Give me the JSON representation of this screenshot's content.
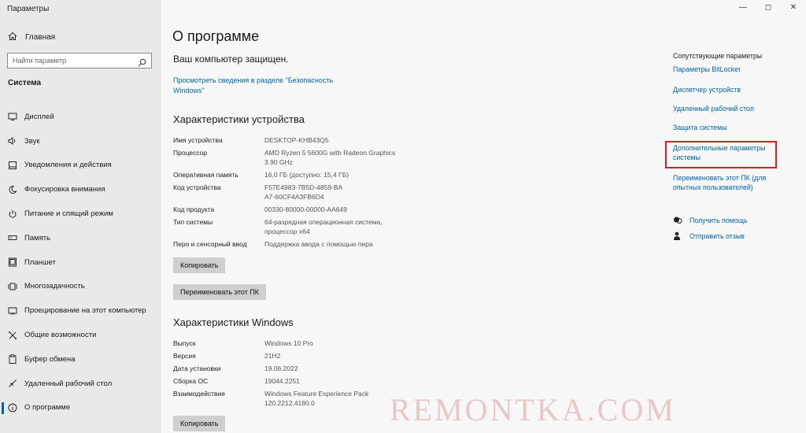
{
  "window": {
    "title": "Параметры",
    "controls": [
      "—",
      "◻",
      "✕"
    ]
  },
  "sidebar": {
    "home": "Главная",
    "search_placeholder": "Найти параметр",
    "section": "Система",
    "items": [
      {
        "label": "Дисплей",
        "icon": "display-icon"
      },
      {
        "label": "Звук",
        "icon": "sound-icon"
      },
      {
        "label": "Уведомления и действия",
        "icon": "notifications-icon"
      },
      {
        "label": "Фокусировка внимания",
        "icon": "focus-moon-icon"
      },
      {
        "label": "Питание и спящий режим",
        "icon": "power-icon"
      },
      {
        "label": "Память",
        "icon": "storage-icon"
      },
      {
        "label": "Планшет",
        "icon": "tablet-icon"
      },
      {
        "label": "Многозадачность",
        "icon": "multitasking-icon"
      },
      {
        "label": "Проецирование на этот компьютер",
        "icon": "projecting-icon"
      },
      {
        "label": "Общие возможности",
        "icon": "shared-experiences-icon"
      },
      {
        "label": "Буфер обмена",
        "icon": "clipboard-icon"
      },
      {
        "label": "Удаленный рабочий стол",
        "icon": "remote-desktop-icon"
      },
      {
        "label": "О программе",
        "icon": "about-info-icon",
        "active": true
      }
    ]
  },
  "main": {
    "title": "О программе",
    "protected": "Ваш компьютер защищен.",
    "security_link": "Просмотреть сведения в разделе \"Безопасность Windows\"",
    "device_specs": {
      "heading": "Характеристики устройства",
      "rows": [
        {
          "key": "Имя устройства",
          "value": "DESKTOP-KHB43Q5"
        },
        {
          "key": "Процессор",
          "value": "AMD Ryzen 5 5600G with Radeon Graphics 3.90 GHz"
        },
        {
          "key": "Оперативная память",
          "value": "16,0 ГБ (доступно: 15,4 ГБ)"
        },
        {
          "key": "Код устройства",
          "value": "F57E4983-7B5D-4859-BAA7-60CF4A3FB6D4"
        },
        {
          "key": "Код продукта",
          "value": "00330-80000-00000-AA649"
        },
        {
          "key": "Тип системы",
          "value": "64-разрядная операционная система, процессор x64"
        },
        {
          "key": "Перо и сенсорный ввод",
          "value": "Поддержка ввода с помощью пера"
        }
      ],
      "copy_button": "Копировать",
      "rename_button": "Переименовать этот ПК"
    },
    "windows_specs": {
      "heading": "Характеристики Windows",
      "rows": [
        {
          "key": "Выпуск",
          "value": "Windows 10 Pro"
        },
        {
          "key": "Версия",
          "value": "21H2"
        },
        {
          "key": "Дата установки",
          "value": "19.06.2022"
        },
        {
          "key": "Сборка ОС",
          "value": "19044.2251"
        },
        {
          "key": "Взаимодействие",
          "value": "Windows Feature Experience Pack 120.2212.4180.0"
        }
      ],
      "copy_button": "Копировать"
    }
  },
  "related": {
    "heading": "Сопутствующие параметры",
    "links": [
      "Параметры BitLocker",
      "Диспетчер устройств",
      "Удаленный рабочий стол",
      "Защита системы",
      "Дополнительные параметры системы",
      "Переименовать этот ПК (для опытных пользователей)"
    ],
    "highlighted_link_index": 4,
    "highlight_color": "#d41e22",
    "help": "Получить помощь",
    "feedback": "Отправить отзыв"
  },
  "colors": {
    "accent": "#0063b1",
    "sidebar_bg": "#e9e9e9",
    "main_bg": "#f7f7f7",
    "button_bg": "#cfcfcf"
  },
  "watermark": "REMONTKA.COM"
}
